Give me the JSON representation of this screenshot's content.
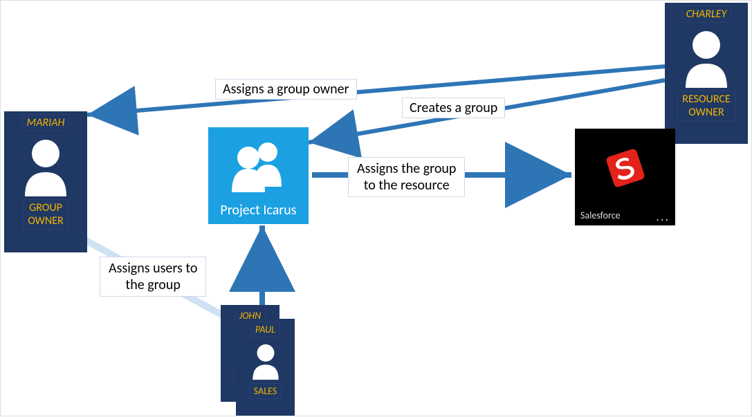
{
  "people": {
    "charley": {
      "name": "CHARLEY",
      "role": "RESOURCE\nOWNER"
    },
    "mariah": {
      "name": "MARIAH",
      "role": "GROUP\nOWNER"
    },
    "john": {
      "name": "JOHN",
      "role": "SALES"
    },
    "paul": {
      "name": "PAUL",
      "role": "SALES"
    }
  },
  "group": {
    "label": "Project Icarus"
  },
  "app": {
    "label": "Salesforce",
    "menu": "..."
  },
  "arrows": {
    "assign_owner": "Assigns a group owner",
    "creates_group": "Creates a group",
    "assign_group_to_resource_l1": "Assigns the group",
    "assign_group_to_resource_l2": "to the resource",
    "assign_users_l1": "Assigns users to",
    "assign_users_l2": "the group"
  },
  "colors": {
    "card_bg": "#1f3864",
    "accent_text": "#f4b400",
    "tile_bg": "#1ba1e2",
    "arrow": "#2e75b6"
  }
}
